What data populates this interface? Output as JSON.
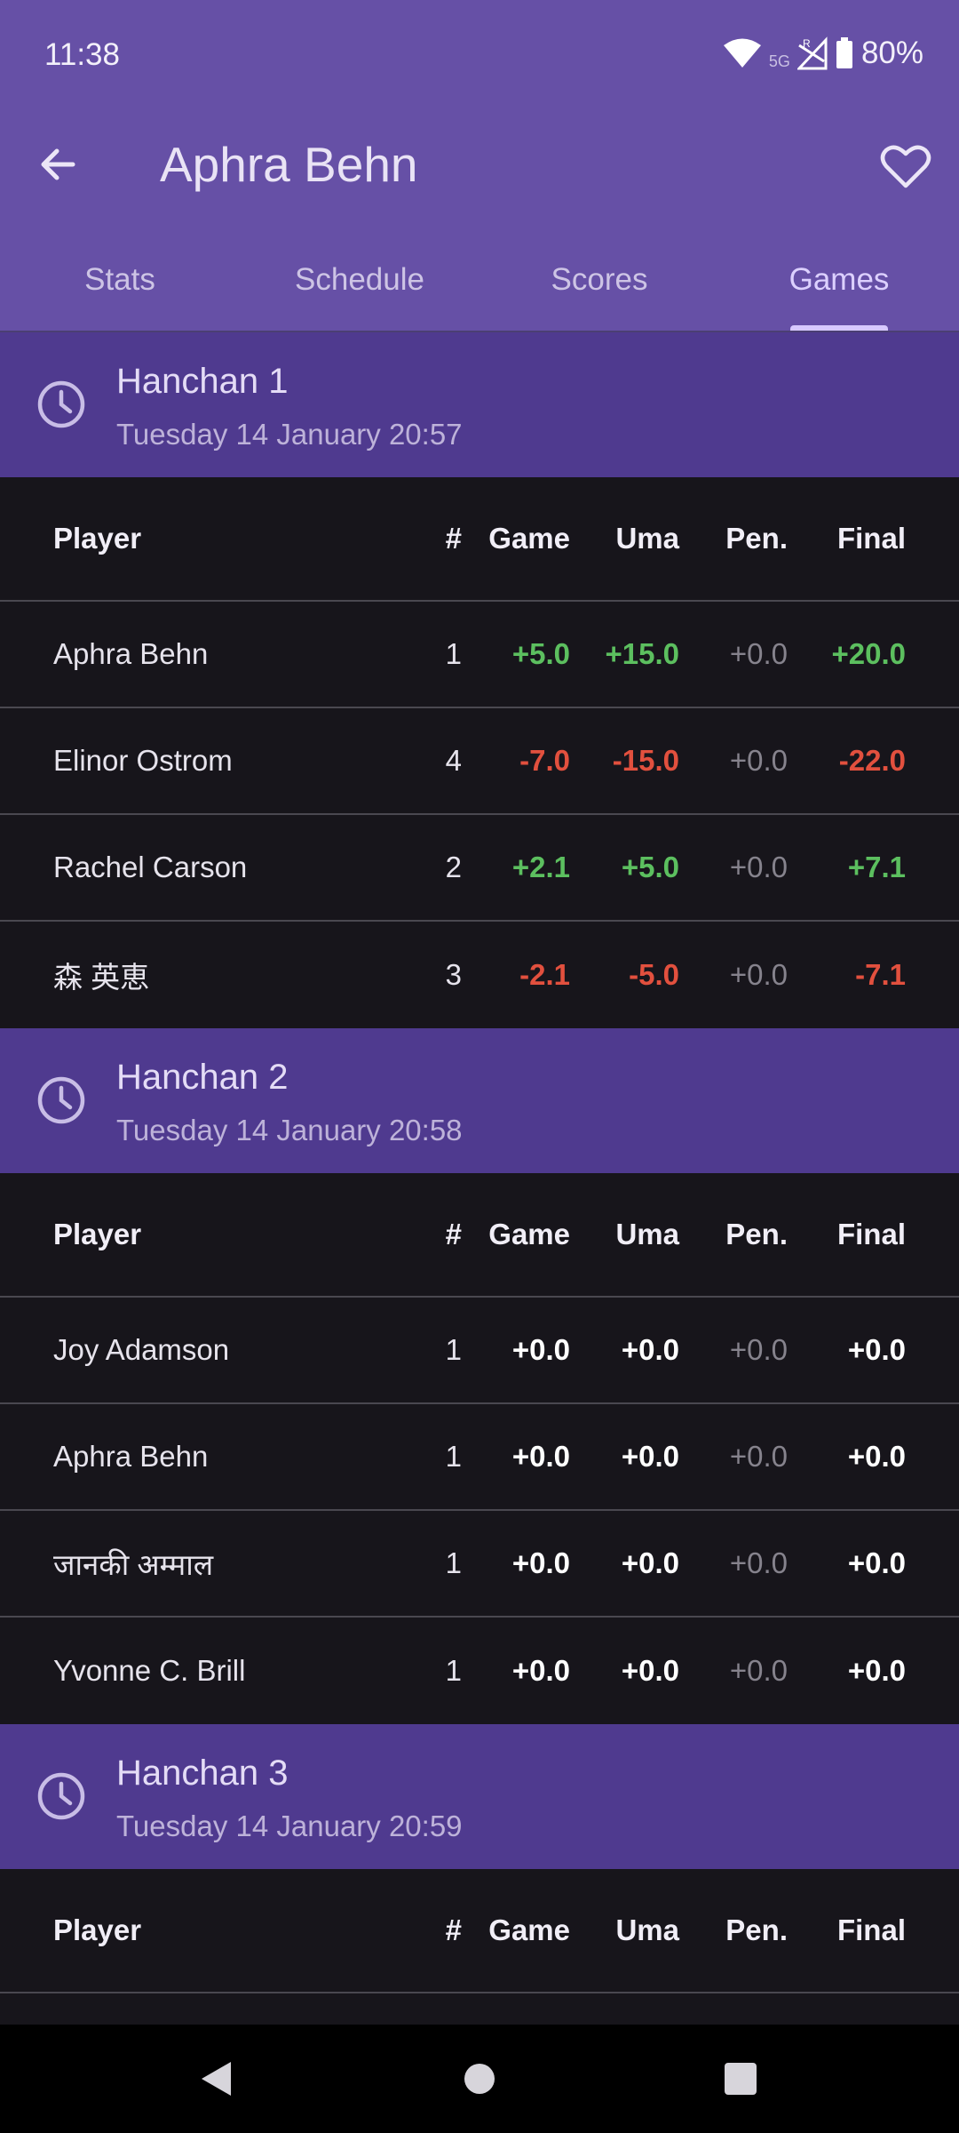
{
  "status_bar": {
    "time": "11:38",
    "network": "5G",
    "battery": "80%"
  },
  "app_bar": {
    "title": "Aphra Behn",
    "back_icon": "arrow-back-icon",
    "favorite_icon": "heart-outline-icon"
  },
  "tabs": [
    {
      "label": "Stats",
      "active": false
    },
    {
      "label": "Schedule",
      "active": false
    },
    {
      "label": "Scores",
      "active": false
    },
    {
      "label": "Games",
      "active": true
    }
  ],
  "table_headers": {
    "player": "Player",
    "pos": "#",
    "game": "Game",
    "uma": "Uma",
    "pen": "Pen.",
    "final": "Final"
  },
  "colors": {
    "positive": "#5cbf5f",
    "negative": "#e2503e",
    "neutral": "#ffffff",
    "penalty": "#86838d",
    "header_bg": "#4f3a8f",
    "app_bar": "#6650a6"
  },
  "games": [
    {
      "title": "Hanchan 1",
      "date": "Tuesday 14 January 20:57",
      "rows": [
        {
          "player": "Aphra Behn",
          "pos": "1",
          "game": "+5.0",
          "uma": "+15.0",
          "pen": "+0.0",
          "final": "+20.0"
        },
        {
          "player": "Elinor Ostrom",
          "pos": "4",
          "game": "-7.0",
          "uma": "-15.0",
          "pen": "+0.0",
          "final": "-22.0"
        },
        {
          "player": "Rachel Carson",
          "pos": "2",
          "game": "+2.1",
          "uma": "+5.0",
          "pen": "+0.0",
          "final": "+7.1"
        },
        {
          "player": "森 英恵",
          "pos": "3",
          "game": "-2.1",
          "uma": "-5.0",
          "pen": "+0.0",
          "final": "-7.1"
        }
      ]
    },
    {
      "title": "Hanchan 2",
      "date": "Tuesday 14 January 20:58",
      "rows": [
        {
          "player": "Joy Adamson",
          "pos": "1",
          "game": "+0.0",
          "uma": "+0.0",
          "pen": "+0.0",
          "final": "+0.0"
        },
        {
          "player": "Aphra Behn",
          "pos": "1",
          "game": "+0.0",
          "uma": "+0.0",
          "pen": "+0.0",
          "final": "+0.0"
        },
        {
          "player": "जानकी अम्माल",
          "pos": "1",
          "game": "+0.0",
          "uma": "+0.0",
          "pen": "+0.0",
          "final": "+0.0"
        },
        {
          "player": "Yvonne C. Brill",
          "pos": "1",
          "game": "+0.0",
          "uma": "+0.0",
          "pen": "+0.0",
          "final": "+0.0"
        }
      ]
    },
    {
      "title": "Hanchan 3",
      "date": "Tuesday 14 January 20:59",
      "rows": []
    }
  ],
  "nav_bar": {
    "back": "nav-back-icon",
    "home": "nav-home-icon",
    "recents": "nav-recents-icon"
  }
}
